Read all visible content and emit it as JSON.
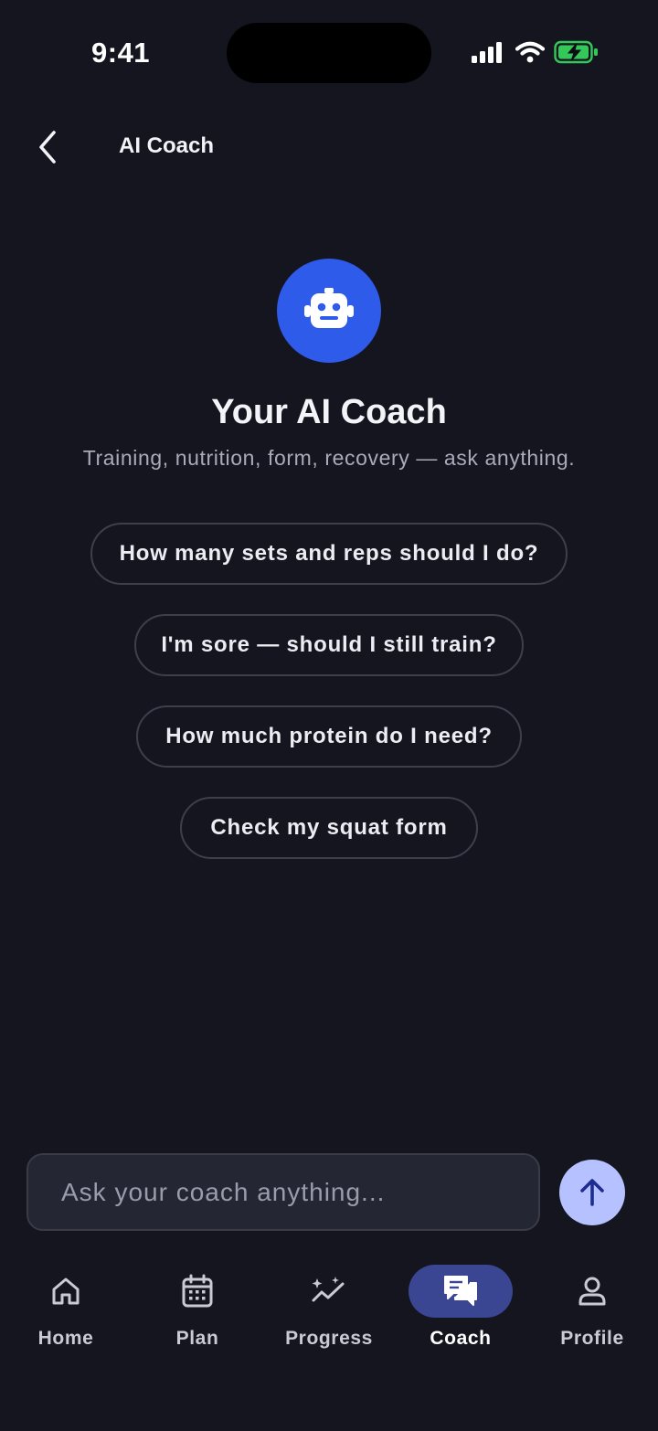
{
  "status_bar": {
    "time": "9:41"
  },
  "header": {
    "title": "AI Coach"
  },
  "hero": {
    "title": "Your AI Coach",
    "subtitle": "Training, nutrition, form, recovery — ask anything."
  },
  "suggestions": [
    {
      "label": "How many sets and reps should I do?"
    },
    {
      "label": "I'm sore — should I still train?"
    },
    {
      "label": "How much protein do I need?"
    },
    {
      "label": "Check my squat form"
    }
  ],
  "composer": {
    "placeholder": "Ask your coach anything...",
    "value": ""
  },
  "nav": {
    "items": [
      {
        "label": "Home",
        "icon": "home-icon"
      },
      {
        "label": "Plan",
        "icon": "calendar-icon"
      },
      {
        "label": "Progress",
        "icon": "progress-sparkle-icon"
      },
      {
        "label": "Coach",
        "icon": "chat-bubbles-icon",
        "active": true
      },
      {
        "label": "Profile",
        "icon": "person-icon"
      }
    ]
  },
  "colors": {
    "background": "#14151f",
    "accent": "#2f5bea",
    "send_button": "#b6c2ff",
    "nav_active_pill": "#3a4691",
    "battery_green": "#34c759"
  }
}
